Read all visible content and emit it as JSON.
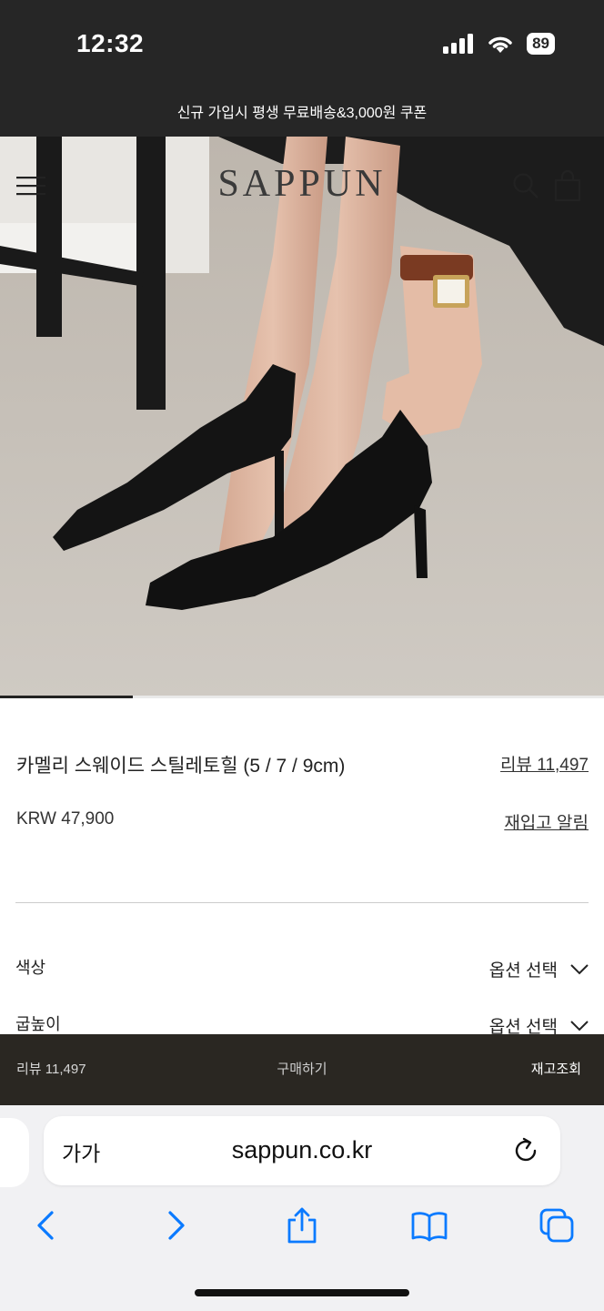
{
  "status_bar": {
    "time": "12:32",
    "battery": "89"
  },
  "promo_banner": {
    "text": "신규 가입시 평생 무료배송&3,000원 쿠폰"
  },
  "header": {
    "logo": "SAPPUN",
    "menu_icon": "hamburger-icon",
    "search_icon": "search-icon",
    "cart_icon": "shopping-bag-icon"
  },
  "gallery": {
    "progress": 0.22
  },
  "product": {
    "name": "카멜리 스웨이드 스틸레토힐 (5 / 7 / 9cm)",
    "review_link": "리뷰 11,497",
    "price": "KRW 47,900",
    "restock_link": "재입고 알림"
  },
  "options": [
    {
      "label": "색상",
      "select": "옵션 선택"
    },
    {
      "label": "굽높이",
      "select": "옵션 선택"
    }
  ],
  "action_bar": {
    "review": "리뷰 11,497",
    "buy": "구매하기",
    "restock": "재고조회"
  },
  "browser": {
    "aa_label": "가가",
    "url": "sappun.co.kr",
    "toolbar_icons": [
      "back-icon",
      "forward-icon",
      "share-icon",
      "bookmarks-icon",
      "tabs-icon"
    ]
  },
  "colors": {
    "banner_bg": "#262626",
    "action_bar_bg": "#2a2722",
    "ios_blue": "#0a7aff"
  }
}
